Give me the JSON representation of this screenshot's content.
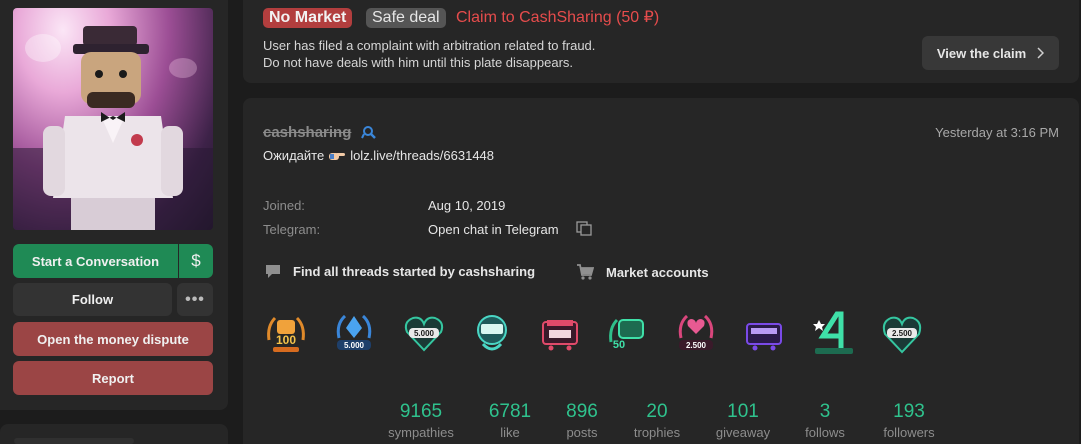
{
  "sidebar": {
    "buttons": {
      "start_conversation": "Start a Conversation",
      "dollar": "$",
      "follow": "Follow",
      "more": "•••",
      "money_dispute": "Open the money dispute",
      "report": "Report"
    }
  },
  "notice": {
    "tag_market": "No Market",
    "tag_safe": "Safe deal",
    "claim_title": "Claim to CashSharing (50 ₽)",
    "line1": "User has filed a complaint with arbitration related to fraud.",
    "line2": "Do not have deals with him until this plate disappears.",
    "view_claim": "View the claim"
  },
  "profile": {
    "username": "cashsharing",
    "timestamp": "Yesterday at 3:16 PM",
    "status_text": "Ожидайте",
    "status_link": "lolz.live/threads/6631448",
    "joined_label": "Joined:",
    "joined_value": "Aug 10, 2019",
    "telegram_label": "Telegram:",
    "telegram_value": "Open chat in Telegram",
    "find_threads": "Find all threads started by cashsharing",
    "market_accounts": "Market accounts",
    "trophy_icons": [
      "100-giveaways-trophy-icon",
      "5000-likes-blue-trophy-icon",
      "5000-likes-heart-trophy-icon",
      "sympathy-trophy-icon",
      "2500-sales-trophy-icon",
      "50-giveaways-trophy-icon",
      "2500-likes-pink-trophy-icon",
      "500-sales-trophy-icon",
      "4-years-trophy-icon",
      "2500-likes-green-trophy-icon"
    ]
  },
  "stats": [
    {
      "num": "9165",
      "cap": "sympathies"
    },
    {
      "num": "6781",
      "cap": "like"
    },
    {
      "num": "896",
      "cap": "posts"
    },
    {
      "num": "20",
      "cap": "trophies"
    },
    {
      "num": "101",
      "cap": "giveaway"
    },
    {
      "num": "3",
      "cap": "follows"
    },
    {
      "num": "193",
      "cap": "followers"
    }
  ],
  "colors": {
    "accent_green": "#2fc28d",
    "button_green": "#1f8a55",
    "danger": "#9b4545",
    "claim_red": "#e64c4c"
  }
}
